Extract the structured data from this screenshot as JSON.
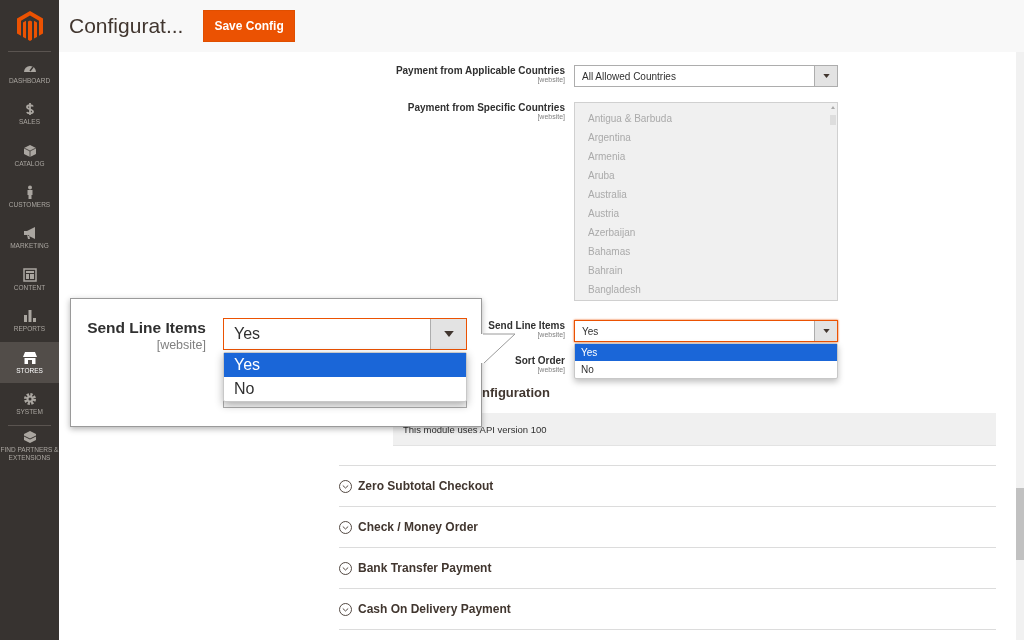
{
  "sidebar": {
    "items": [
      {
        "label": "DASHBOARD",
        "selected": false
      },
      {
        "label": "SALES",
        "selected": false
      },
      {
        "label": "CATALOG",
        "selected": false
      },
      {
        "label": "CUSTOMERS",
        "selected": false
      },
      {
        "label": "MARKETING",
        "selected": false
      },
      {
        "label": "CONTENT",
        "selected": false
      },
      {
        "label": "REPORTS",
        "selected": false
      },
      {
        "label": "STORES",
        "selected": true
      },
      {
        "label": "SYSTEM",
        "selected": false
      },
      {
        "label": "FIND PARTNERS & EXTENSIONS",
        "selected": false
      }
    ]
  },
  "header": {
    "title": "Configurat...",
    "button": "Save Config"
  },
  "fields": [
    {
      "kind": "select",
      "label": "Payment from Applicable Countries",
      "scope": "[website]",
      "value": "All Allowed Countries",
      "focused": false
    },
    {
      "kind": "multiselect",
      "label": "Payment from Specific Countries",
      "scope": "[website]",
      "disabled": true,
      "options": [
        "Antigua & Barbuda",
        "Argentina",
        "Armenia",
        "Aruba",
        "Australia",
        "Austria",
        "Azerbaijan",
        "Bahamas",
        "Bahrain",
        "Bangladesh"
      ]
    },
    {
      "kind": "select",
      "label": "Send Line Items",
      "scope": "[website]",
      "value": "Yes",
      "focused": true,
      "options": [
        {
          "label": "Yes",
          "selected": true
        },
        {
          "label": "No",
          "selected": false
        }
      ]
    },
    {
      "kind": "covered",
      "label": "Sort Order",
      "scope": "[website]"
    }
  ],
  "section_heading": "nfiguration",
  "note": "This module uses API version 100",
  "sections": [
    {
      "title": "Zero Subtotal Checkout",
      "expanded": false
    },
    {
      "title": "Check / Money Order",
      "expanded": false
    },
    {
      "title": "Bank Transfer Payment",
      "expanded": false
    },
    {
      "title": "Cash On Delivery Payment",
      "expanded": false
    }
  ],
  "callout": {
    "label": "Send Line Items",
    "scope": "[website]",
    "value": "Yes",
    "focused": true,
    "options": [
      {
        "label": "Yes",
        "selected": true
      },
      {
        "label": "No",
        "selected": false
      }
    ]
  }
}
